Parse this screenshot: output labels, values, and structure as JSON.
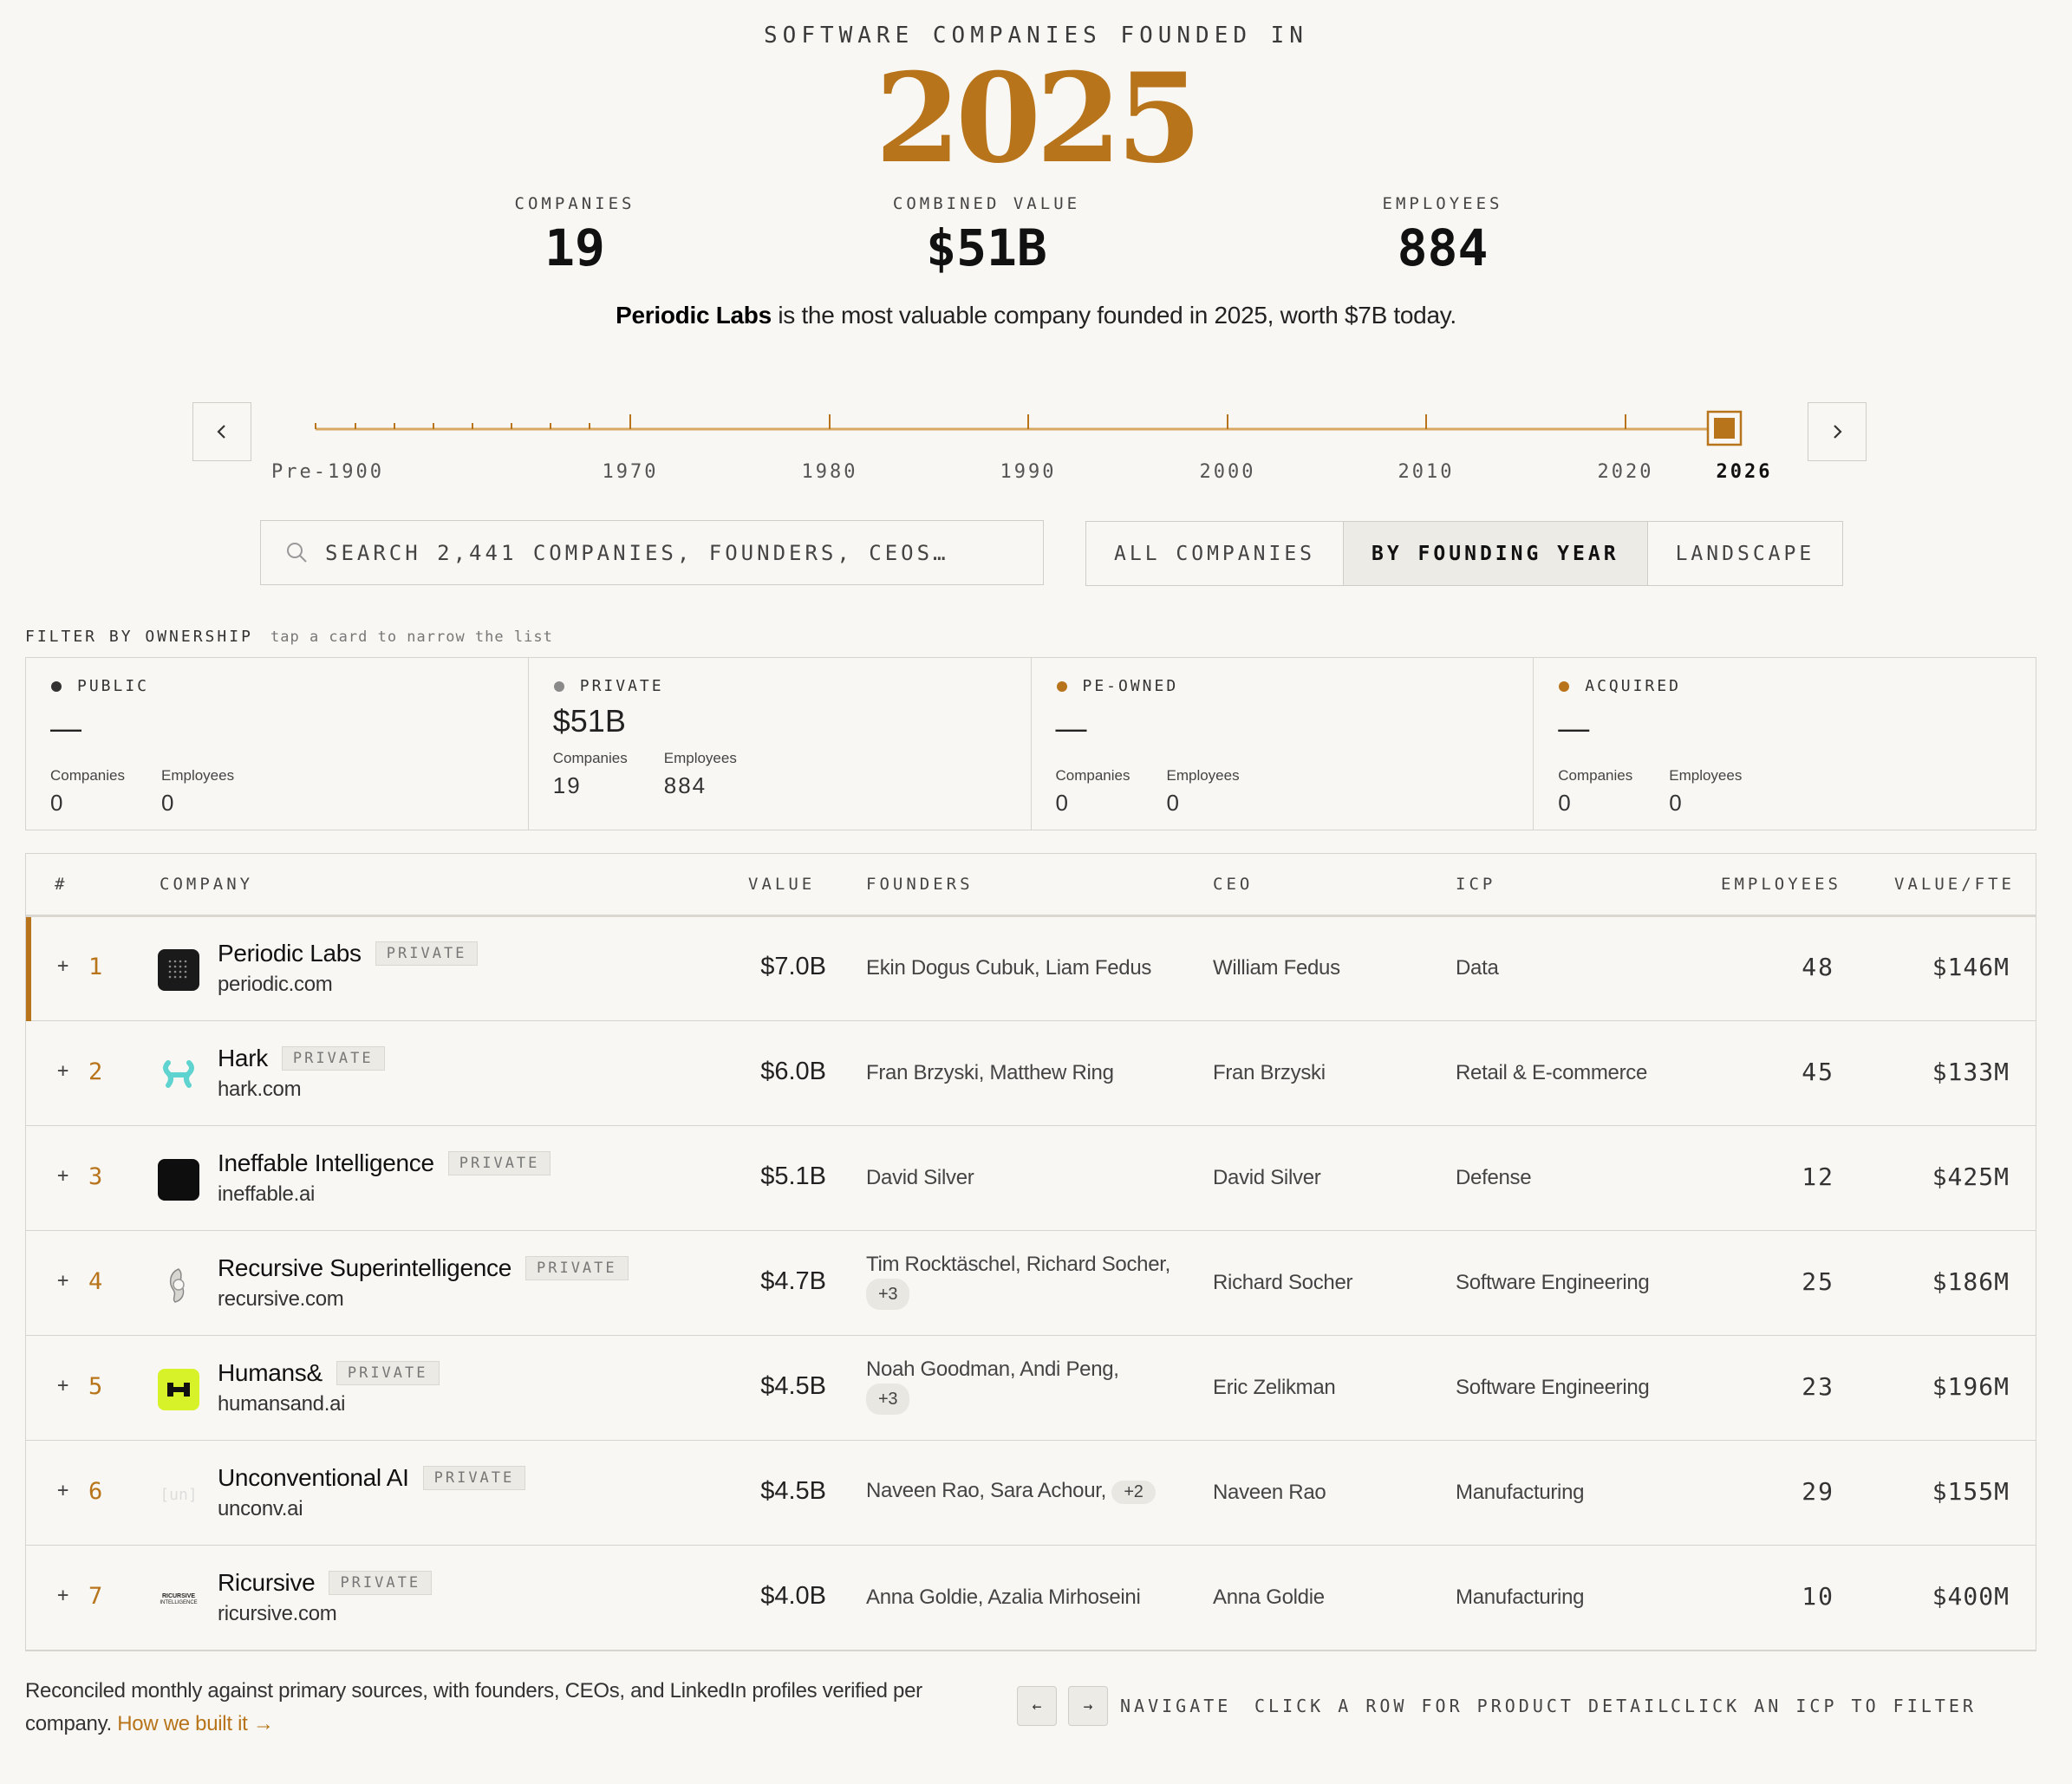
{
  "header": {
    "eyebrow": "SOFTWARE COMPANIES FOUNDED IN",
    "year": "2025",
    "stats": [
      {
        "label": "COMPANIES",
        "value": "19"
      },
      {
        "label": "COMBINED VALUE",
        "value": "$51B"
      },
      {
        "label": "EMPLOYEES",
        "value": "884"
      }
    ],
    "tagline_company": "Periodic Labs",
    "tagline_rest": " is the most valuable company founded in 2025, worth $7B today."
  },
  "timeline": {
    "labels": [
      "Pre-1900",
      "1970",
      "1980",
      "1990",
      "2000",
      "2010",
      "2020",
      "2026"
    ],
    "active": "2026",
    "prev_icon": "chevron-left-icon",
    "next_icon": "chevron-right-icon"
  },
  "search": {
    "placeholder": "SEARCH 2,441 COMPANIES, FOUNDERS, CEOS…",
    "icon": "search-icon"
  },
  "tabs": [
    {
      "label": "ALL COMPANIES",
      "active": false
    },
    {
      "label": "BY FOUNDING YEAR",
      "active": true
    },
    {
      "label": "LANDSCAPE",
      "active": false
    }
  ],
  "filter": {
    "title": "FILTER BY OWNERSHIP",
    "hint": "tap a card to narrow the list",
    "cards": [
      {
        "label": "PUBLIC",
        "color": "#333333",
        "value": "—",
        "companies_label": "Companies",
        "companies": "0",
        "employees_label": "Employees",
        "employees": "0"
      },
      {
        "label": "PRIVATE",
        "color": "#8a8a8a",
        "value": "$51B",
        "companies_label": "Companies",
        "companies": "19",
        "employees_label": "Employees",
        "employees": "884"
      },
      {
        "label": "PE-OWNED",
        "color": "#b8741a",
        "value": "—",
        "companies_label": "Companies",
        "companies": "0",
        "employees_label": "Employees",
        "employees": "0"
      },
      {
        "label": "ACQUIRED",
        "color": "#b8741a",
        "value": "—",
        "companies_label": "Companies",
        "companies": "0",
        "employees_label": "Employees",
        "employees": "0"
      }
    ]
  },
  "table": {
    "columns": {
      "rank": "#",
      "company": "COMPANY",
      "value": "VALUE",
      "founders": "FOUNDERS",
      "ceo": "CEO",
      "icp": "ICP",
      "employees": "EMPLOYEES",
      "value_fte": "VALUE/FTE"
    },
    "expand_symbol": "+",
    "rows": [
      {
        "rank": "1",
        "name": "Periodic Labs",
        "badge": "PRIVATE",
        "domain": "periodic.com",
        "value": "$7.0B",
        "founders": "Ekin Dogus Cubuk, Liam Fedus",
        "founders_more": "",
        "ceo": "William Fedus",
        "icp": "Data",
        "employees": "48",
        "value_fte": "$146M",
        "logo": "periodic-logo"
      },
      {
        "rank": "2",
        "name": "Hark",
        "badge": "PRIVATE",
        "domain": "hark.com",
        "value": "$6.0B",
        "founders": "Fran Brzyski, Matthew Ring",
        "founders_more": "",
        "ceo": "Fran Brzyski",
        "icp": "Retail & E-commerce",
        "employees": "45",
        "value_fte": "$133M",
        "logo": "hark-logo"
      },
      {
        "rank": "3",
        "name": "Ineffable Intelligence",
        "badge": "PRIVATE",
        "domain": "ineffable.ai",
        "value": "$5.1B",
        "founders": "David Silver",
        "founders_more": "",
        "ceo": "David Silver",
        "icp": "Defense",
        "employees": "12",
        "value_fte": "$425M",
        "logo": "ineffable-logo"
      },
      {
        "rank": "4",
        "name": "Recursive Superintelligence",
        "badge": "PRIVATE",
        "domain": "recursive.com",
        "value": "$4.7B",
        "founders": "Tim Rocktäschel, Richard Socher,",
        "founders_more": "+3",
        "ceo": "Richard Socher",
        "icp": "Software Engineering",
        "employees": "25",
        "value_fte": "$186M",
        "logo": "recursive-logo"
      },
      {
        "rank": "5",
        "name": "Humans&",
        "badge": "PRIVATE",
        "domain": "humansand.ai",
        "value": "$4.5B",
        "founders": "Noah Goodman, Andi Peng,",
        "founders_more": "+3",
        "ceo": "Eric Zelikman",
        "icp": "Software Engineering",
        "employees": "23",
        "value_fte": "$196M",
        "logo": "humans-logo"
      },
      {
        "rank": "6",
        "name": "Unconventional AI",
        "badge": "PRIVATE",
        "domain": "unconv.ai",
        "value": "$4.5B",
        "founders": "Naveen Rao, Sara Achour,",
        "founders_more": "+2",
        "ceo": "Naveen Rao",
        "icp": "Manufacturing",
        "employees": "29",
        "value_fte": "$155M",
        "logo": "unconventional-logo"
      },
      {
        "rank": "7",
        "name": "Ricursive",
        "badge": "PRIVATE",
        "domain": "ricursive.com",
        "value": "$4.0B",
        "founders": "Anna Goldie, Azalia Mirhoseini",
        "founders_more": "",
        "ceo": "Anna Goldie",
        "icp": "Manufacturing",
        "employees": "10",
        "value_fte": "$400M",
        "logo": "ricursive-logo"
      }
    ]
  },
  "logos": {
    "unconventional_text": "[un]",
    "ricursive_text_1": "RICURSIVE",
    "ricursive_text_2": "INTELLIGENCE"
  },
  "footer": {
    "note": "Reconciled monthly against primary sources, with founders, CEOs, and LinkedIn profiles verified per company. ",
    "link": "How we built it →",
    "key_left": "←",
    "key_right": "→",
    "hints": [
      "NAVIGATE",
      "CLICK A ROW FOR PRODUCT DETAIL",
      "CLICK AN ICP TO FILTER"
    ]
  },
  "colors": {
    "accent": "#b8741a",
    "background": "#f8f7f3",
    "border": "#d6d4cd"
  }
}
